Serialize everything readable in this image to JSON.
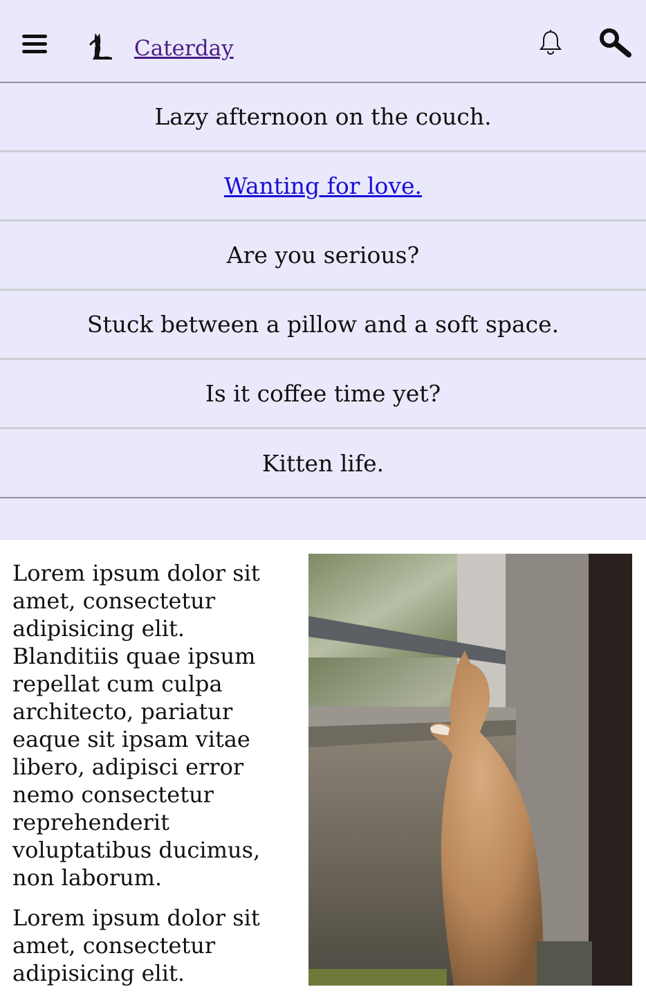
{
  "header": {
    "brand": "Caterday",
    "icons": [
      "menu-icon",
      "cat-logo-icon",
      "bell-icon",
      "search-icon"
    ]
  },
  "nav": {
    "items": [
      {
        "label": "Lazy afternoon on the couch."
      },
      {
        "label": "Wanting for love."
      },
      {
        "label": "Are you serious?"
      },
      {
        "label": "Stuck between a pillow and a soft space."
      },
      {
        "label": "Is it coffee time yet?"
      },
      {
        "label": "Kitten life."
      }
    ]
  },
  "article": {
    "paragraphs": [
      "Lorem ipsum dolor sit amet, consectetur adipisicing elit. Blanditiis quae ipsum repellat cum culpa architecto, pariatur eaque sit ipsam vitae libero, adipisci error nemo consectetur reprehenderit voluptatibus ducimus, non laborum.",
      "Lorem ipsum dolor sit amet, consectetur adipisicing elit."
    ]
  },
  "colors": {
    "header_bg": "#e9e9fb",
    "brand_link": "#4b1c86",
    "active_link": "#1a0dd8"
  }
}
